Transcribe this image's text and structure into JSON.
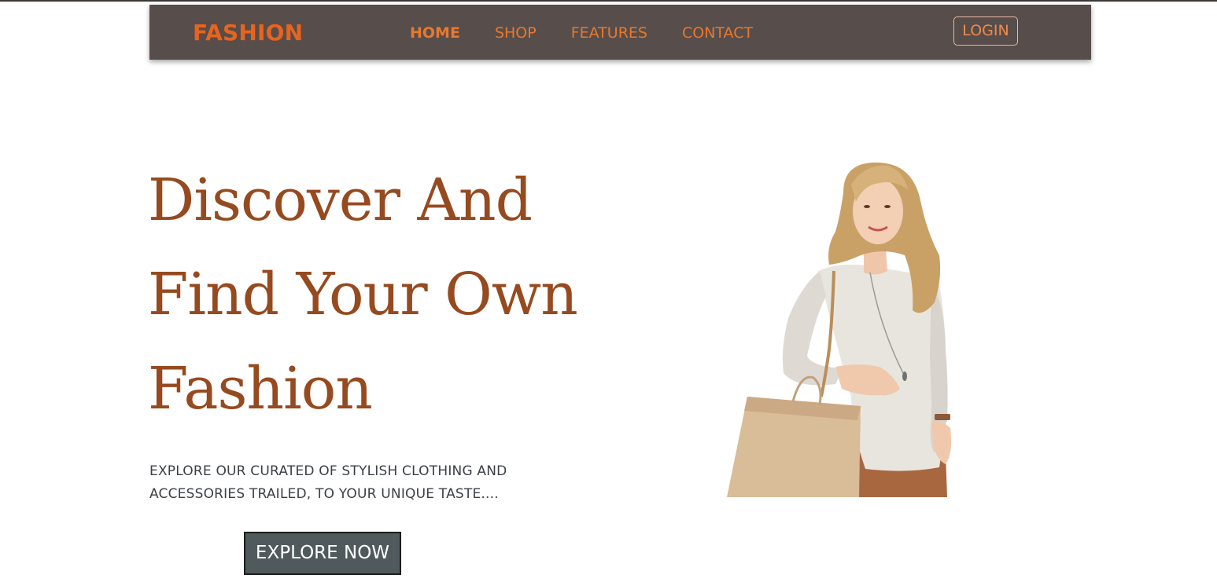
{
  "navbar": {
    "brand": "FASHION",
    "links": [
      {
        "label": "HOME",
        "active": true
      },
      {
        "label": "SHOP",
        "active": false
      },
      {
        "label": "FEATURES",
        "active": false
      },
      {
        "label": "CONTACT",
        "active": false
      }
    ],
    "login_label": "LOGIN"
  },
  "hero": {
    "title_lines": [
      "Discover And",
      "Find Your Own",
      "Fashion"
    ],
    "subtitle_lines": [
      "EXPLORE OUR CURATED OF STYLISH CLOTHING AND",
      "ACCESSORIES TRAILED, TO YOUR UNIQUE TASTE...."
    ],
    "cta_label": "EXPLORE NOW"
  },
  "colors": {
    "navbar_bg": "#574d4b",
    "brand": "#e8641e",
    "nav_link": "#e8792f",
    "hero_title": "#964a1f",
    "hero_text": "#3b4046",
    "cta_bg": "#505a5c"
  },
  "icons": {
    "hero_image": "woman-with-shopping-bag-photo"
  }
}
